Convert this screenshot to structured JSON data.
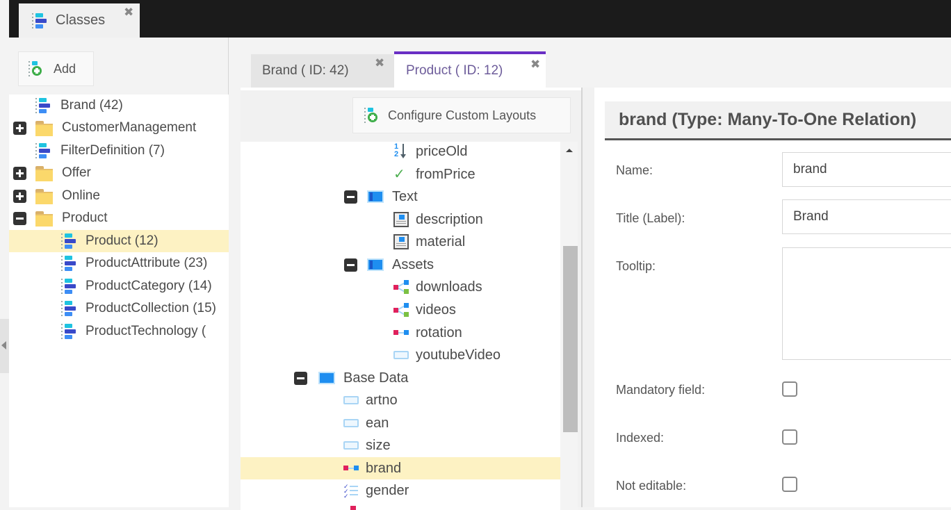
{
  "app": {
    "main_tab": {
      "label": "Classes",
      "icon": "class-icon",
      "close_icon": "close-icon"
    }
  },
  "left_panel": {
    "add_button": {
      "label": "Add",
      "icon": "add-class-icon"
    },
    "tree": [
      {
        "label": "Brand (42)",
        "type": "class",
        "expander": null,
        "depth": 0
      },
      {
        "label": "CustomerManagement",
        "type": "folder",
        "expander": "plus",
        "depth": 0
      },
      {
        "label": "FilterDefinition (7)",
        "type": "class",
        "expander": null,
        "depth": 0
      },
      {
        "label": "Offer",
        "type": "folder",
        "expander": "plus",
        "depth": 0
      },
      {
        "label": "Online",
        "type": "folder",
        "expander": "plus",
        "depth": 0
      },
      {
        "label": "Product",
        "type": "folder",
        "expander": "minus",
        "depth": 0
      },
      {
        "label": "Product (12)",
        "type": "class",
        "expander": null,
        "depth": 1,
        "selected": true
      },
      {
        "label": "ProductAttribute (23)",
        "type": "class",
        "expander": null,
        "depth": 1
      },
      {
        "label": "ProductCategory (14)",
        "type": "class",
        "expander": null,
        "depth": 1
      },
      {
        "label": "ProductCollection (15)",
        "type": "class",
        "expander": null,
        "depth": 1
      },
      {
        "label": "ProductTechnology (",
        "type": "class",
        "expander": null,
        "depth": 1
      }
    ]
  },
  "editor_tabs": [
    {
      "label": "Brand ( ID: 42)",
      "active": false
    },
    {
      "label": "Product ( ID: 12)",
      "active": true
    }
  ],
  "layout_panel": {
    "configure_button": {
      "label": "Configure Custom Layouts",
      "icon": "configure-layouts-icon"
    },
    "tree": [
      {
        "label": "priceOld",
        "icon": "numeric-icon"
      },
      {
        "label": "fromPrice",
        "icon": "checkbox-icon"
      },
      {
        "label": "Text",
        "icon": "panel-icon",
        "expander": "minus"
      },
      {
        "label": "description",
        "icon": "wysiwyg-icon"
      },
      {
        "label": "material",
        "icon": "wysiwyg-icon"
      },
      {
        "label": "Assets",
        "icon": "panel-icon",
        "expander": "minus"
      },
      {
        "label": "downloads",
        "icon": "many-to-many-relation-icon"
      },
      {
        "label": "videos",
        "icon": "many-to-many-relation-icon"
      },
      {
        "label": "rotation",
        "icon": "many-to-one-relation-icon"
      },
      {
        "label": "youtubeVideo",
        "icon": "input-icon"
      },
      {
        "label": "Base Data",
        "icon": "panel-icon",
        "expander": "minus"
      },
      {
        "label": "artno",
        "icon": "input-icon"
      },
      {
        "label": "ean",
        "icon": "input-icon"
      },
      {
        "label": "size",
        "icon": "input-icon"
      },
      {
        "label": "brand",
        "icon": "many-to-one-relation-icon",
        "selected": true
      },
      {
        "label": "gender",
        "icon": "multiselect-icon"
      }
    ]
  },
  "field_settings": {
    "title": "brand (Type: Many-To-One Relation)",
    "name_label": "Name:",
    "name_value": "brand",
    "title_label": "Title (Label):",
    "title_value": "Brand",
    "tooltip_label": "Tooltip:",
    "tooltip_value": "",
    "mandatory_label": "Mandatory field:",
    "mandatory_checked": false,
    "indexed_label": "Indexed:",
    "indexed_checked": false,
    "not_editable_label": "Not editable:",
    "not_editable_checked": false
  },
  "colors": {
    "active_tab_accent": "#6a2fc4",
    "selection_highlight": "#fdf2c3"
  }
}
